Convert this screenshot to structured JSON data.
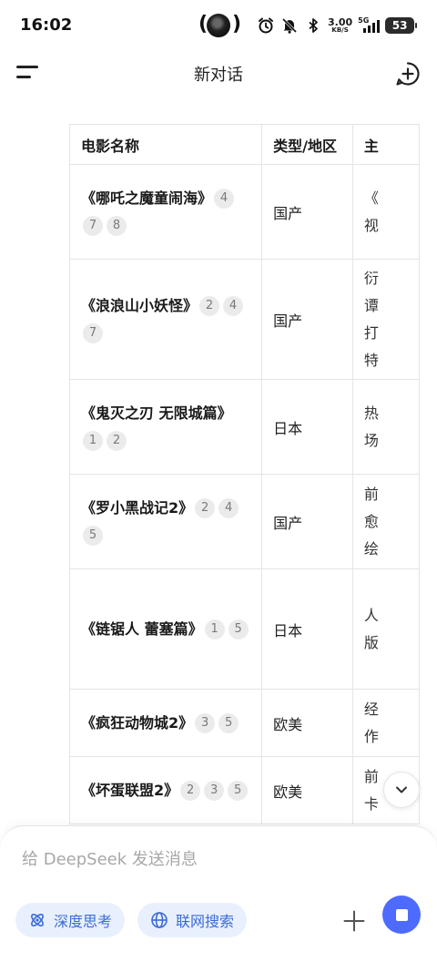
{
  "status_bar": {
    "time": "16:02",
    "net_speed_value": "3.00",
    "net_speed_unit": "KB/S",
    "signal_label": "5G",
    "battery_level": "53",
    "icons": [
      "avatar-icon",
      "alarm-icon",
      "mute-icon",
      "bluetooth-icon",
      "signal-icon",
      "battery-icon"
    ]
  },
  "header": {
    "title": "新对话",
    "icons": [
      "menu-icon",
      "new-chat-icon"
    ]
  },
  "table": {
    "columns": [
      "电影名称",
      "类型/地区",
      "主"
    ],
    "rows": [
      {
        "name": "《哪吒之魔童闹海》",
        "citations": [
          "4",
          "7",
          "8"
        ],
        "type": "国产",
        "desc": "《\n视"
      },
      {
        "name": "《浪浪山小妖怪》",
        "citations": [
          "2",
          "4",
          "7"
        ],
        "type": "国产",
        "desc": "衍\n谭\n打\n特"
      },
      {
        "name": "《鬼灭之刃 无限城篇》",
        "citations": [
          "1",
          "2"
        ],
        "type": "日本",
        "desc": "热\n场"
      },
      {
        "name": "《罗小黑战记2》",
        "citations": [
          "2",
          "4",
          "5"
        ],
        "type": "国产",
        "desc": "前\n愈\n绘"
      },
      {
        "name": "《链锯人 蕾塞篇》",
        "citations": [
          "1",
          "5"
        ],
        "type": "日本",
        "desc": "人\n版"
      },
      {
        "name": "《疯狂动物城2》",
        "citations": [
          "3",
          "5"
        ],
        "type": "欧美",
        "desc": "经\n作"
      },
      {
        "name": "《坏蛋联盟2》",
        "citations": [
          "2",
          "3",
          "5"
        ],
        "type": "欧美",
        "desc": "前\n卡"
      }
    ]
  },
  "composer": {
    "placeholder": "给 DeepSeek 发送消息",
    "chip_think": "深度思考",
    "chip_search": "联网搜索",
    "accent_color": "#4d6bfe",
    "chip_bg": "#e9f0fd",
    "chip_text_color": "#3b6bd6"
  }
}
